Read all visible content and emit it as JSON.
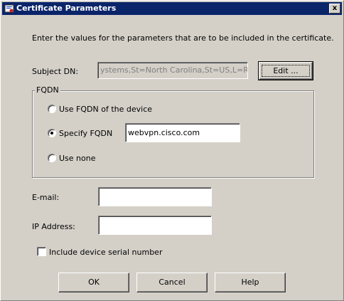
{
  "window": {
    "title": "Certificate Parameters",
    "close_label": "x"
  },
  "intro_text": "Enter the values for the parameters that are to be included in the certificate.",
  "subject_dn": {
    "label": "Subject DN:",
    "value": "ystems,St=North Carolina,St=US,L=Raleigh",
    "edit_button": "Edit ..."
  },
  "fqdn": {
    "group_label": "FQDN",
    "options": [
      {
        "label": "Use FQDN of the device",
        "selected": false
      },
      {
        "label": "Specify FQDN",
        "selected": true
      },
      {
        "label": "Use none",
        "selected": false
      }
    ],
    "specify_value": "webvpn.cisco.com"
  },
  "email": {
    "label": "E-mail:",
    "value": ""
  },
  "ip_address": {
    "label": "IP Address:",
    "value": ""
  },
  "serial": {
    "label": "Include device serial number",
    "checked": false
  },
  "buttons": {
    "ok": "OK",
    "cancel": "Cancel",
    "help": "Help"
  }
}
